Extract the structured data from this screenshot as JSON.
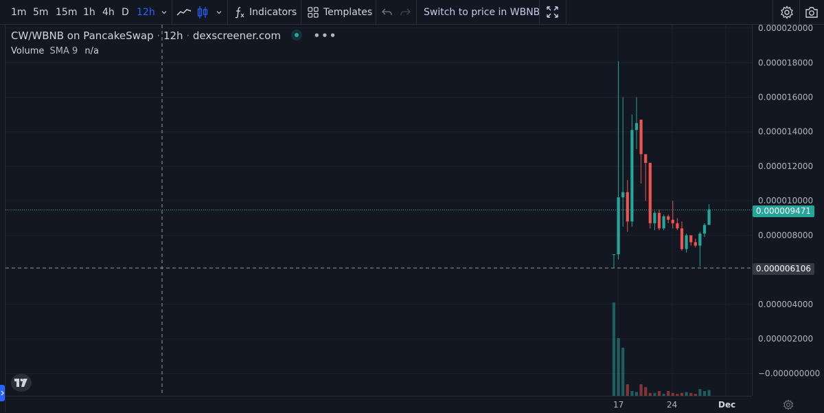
{
  "toolbar": {
    "intervals": [
      {
        "label": "1m",
        "active": false
      },
      {
        "label": "5m",
        "active": false
      },
      {
        "label": "15m",
        "active": false
      },
      {
        "label": "1h",
        "active": false
      },
      {
        "label": "4h",
        "active": false
      },
      {
        "label": "D",
        "active": false
      },
      {
        "label": "12h",
        "active": true
      }
    ],
    "indicators_label": "Indicators",
    "templates_label": "Templates",
    "switch_label": "Switch to price in WBNB"
  },
  "legend": {
    "symbol": "CW/WBNB on PancakeSwap",
    "interval": "12h",
    "source": "dexscreener.com",
    "volume_label": "Volume",
    "sma_label": "SMA 9",
    "sma_value": "n/a"
  },
  "price_scale": {
    "ticks": [
      "0.000020000",
      "0.000018000",
      "0.000016000",
      "0.000014000",
      "0.000012000",
      "0.000010000",
      "0.000008000",
      "0.000004000",
      "0.000002000",
      "−0.000000000"
    ],
    "last_price": "0.000009471",
    "crosshair_price": "0.000006106"
  },
  "time_axis": {
    "labels": [
      "17",
      "24",
      "Dec"
    ]
  },
  "colors": {
    "up": "#26a69a",
    "down": "#ef5350",
    "accent": "#2962ff",
    "background": "#131722"
  },
  "chart_data": {
    "type": "candlestick",
    "ylim": [
      -1.3e-06,
      2.02e-05
    ],
    "candles": [
      {
        "o": 6.9e-06,
        "h": 6.9e-06,
        "l": 6.1e-06,
        "c": 6.9e-06
      },
      {
        "o": 6.9e-06,
        "h": 1.81e-05,
        "l": 6.6e-06,
        "c": 1.02e-05
      },
      {
        "o": 1.02e-05,
        "h": 1.6e-05,
        "l": 8.5e-06,
        "c": 1.05e-05
      },
      {
        "o": 1.05e-05,
        "h": 1.12e-05,
        "l": 8.2e-06,
        "c": 8.8e-06
      },
      {
        "o": 8.8e-06,
        "h": 1.5e-05,
        "l": 8.5e-06,
        "c": 1.41e-05
      },
      {
        "o": 1.41e-05,
        "h": 1.6e-05,
        "l": 1.3e-05,
        "c": 1.45e-05
      },
      {
        "o": 1.47e-05,
        "h": 1.47e-05,
        "l": 1.1e-05,
        "c": 1.27e-05
      },
      {
        "o": 1.27e-05,
        "h": 1.27e-05,
        "l": 1e-05,
        "c": 1.22e-05
      },
      {
        "o": 1.22e-05,
        "h": 1.22e-05,
        "l": 8.4e-06,
        "c": 8.7e-06
      },
      {
        "o": 8.7e-06,
        "h": 9.4e-06,
        "l": 8.3e-06,
        "c": 9.3e-06
      },
      {
        "o": 9.3e-06,
        "h": 9.5e-06,
        "l": 8.3e-06,
        "c": 8.4e-06
      },
      {
        "o": 8.4e-06,
        "h": 9.2e-06,
        "l": 8.3e-06,
        "c": 9.1e-06
      },
      {
        "o": 9.1e-06,
        "h": 9.2e-06,
        "l": 8.7e-06,
        "c": 8.9e-06
      },
      {
        "o": 8.9e-06,
        "h": 1e-05,
        "l": 8.4e-06,
        "c": 8.7e-06
      },
      {
        "o": 8.7e-06,
        "h": 9e-06,
        "l": 8.3e-06,
        "c": 8.4e-06
      },
      {
        "o": 8.4e-06,
        "h": 8.8e-06,
        "l": 7.1e-06,
        "c": 7.2e-06
      },
      {
        "o": 7.2e-06,
        "h": 8.1e-06,
        "l": 7e-06,
        "c": 8e-06
      },
      {
        "o": 8e-06,
        "h": 8e-06,
        "l": 7.4e-06,
        "c": 7.6e-06
      },
      {
        "o": 7.6e-06,
        "h": 7.8e-06,
        "l": 7.3e-06,
        "c": 7.4e-06
      },
      {
        "o": 7.4e-06,
        "h": 8.2e-06,
        "l": 6.2e-06,
        "c": 8.1e-06
      },
      {
        "o": 8.1e-06,
        "h": 8.7e-06,
        "l": 7.9e-06,
        "c": 8.6e-06
      },
      {
        "o": 8.6e-06,
        "h": 9.8e-06,
        "l": 8.6e-06,
        "c": 9.5e-06
      }
    ],
    "volume": [
      0.97,
      0.6,
      0.5,
      0.12,
      0.05,
      0.04,
      0.12,
      0.09,
      0.03,
      0.03,
      0.05,
      0.02,
      0.05,
      0.03,
      0.02,
      0.03,
      0.04,
      0.03,
      0.02,
      0.07,
      0.05,
      0.06
    ]
  }
}
